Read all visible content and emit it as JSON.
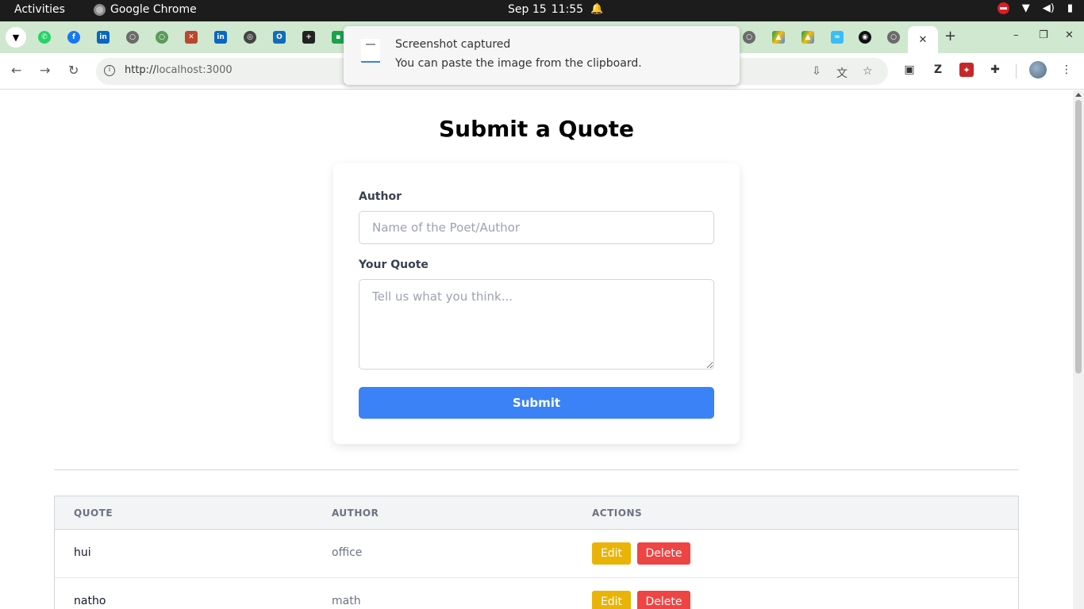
{
  "system_bar": {
    "activities": "Activities",
    "app_name": "Google Chrome",
    "date": "Sep 15",
    "time": "11:55"
  },
  "tabs": {
    "favicons": [
      "whatsapp-icon",
      "facebook-icon",
      "linkedin-icon",
      "globe-icon",
      "globe-green-icon",
      "brand-icon",
      "linkedin-icon",
      "openai-icon",
      "outlook-icon",
      "plus-square-icon",
      "green-app-icon"
    ],
    "right_favicons": [
      "globe-icon",
      "google-drive-icon",
      "google-drive-icon",
      "tailwind-icon",
      "github-icon",
      "globe-icon"
    ]
  },
  "omnibox": {
    "url_scheme": "http://",
    "url_host": "localhost",
    "url_port": ":3000"
  },
  "notification": {
    "title": "Screenshot captured",
    "body": "You can paste the image from the clipboard."
  },
  "page": {
    "title": "Submit a Quote",
    "form": {
      "author_label": "Author",
      "author_placeholder": "Name of the Poet/Author",
      "author_value": "",
      "quote_label": "Your Quote",
      "quote_placeholder": "Tell us what you think...",
      "quote_value": "",
      "submit_label": "Submit"
    },
    "table": {
      "headers": [
        "QUOTE",
        "AUTHOR",
        "ACTIONS"
      ],
      "rows": [
        {
          "quote": "hui",
          "author": "office",
          "edit": "Edit",
          "delete": "Delete"
        },
        {
          "quote": "natho",
          "author": "math",
          "edit": "Edit",
          "delete": "Delete"
        }
      ]
    }
  },
  "colors": {
    "primary": "#3b82f6",
    "edit": "#eab308",
    "delete": "#ef4444",
    "tabstrip": "#cfe8cf"
  }
}
